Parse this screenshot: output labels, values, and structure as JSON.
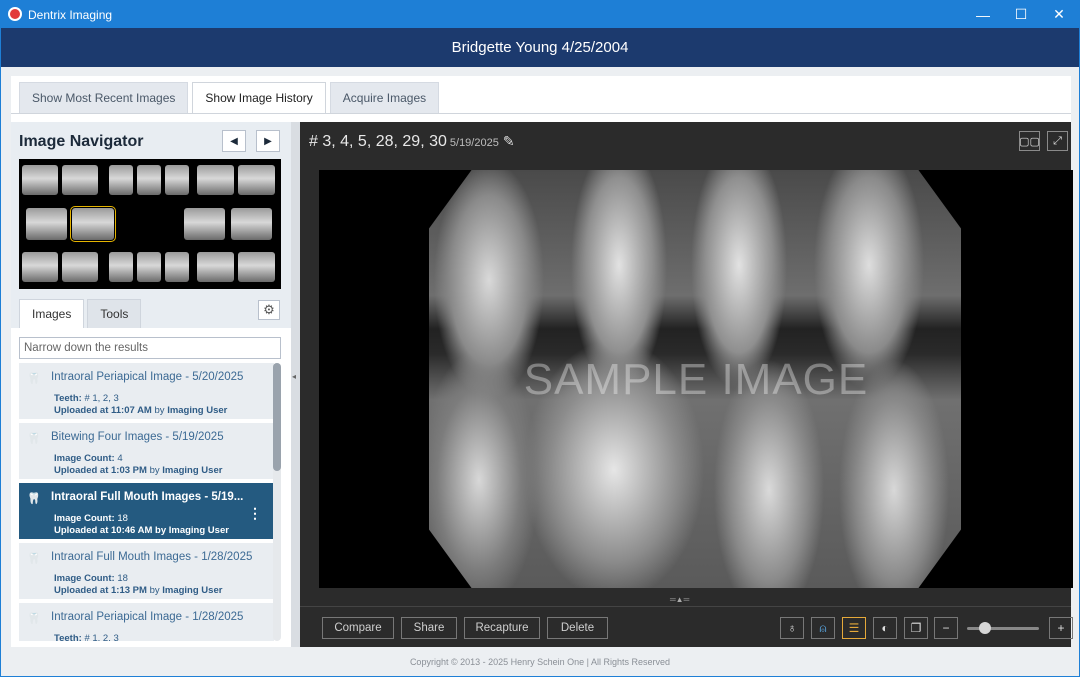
{
  "window": {
    "title": "Dentrix Imaging",
    "controls": {
      "minimize": "—",
      "maximize": "☐",
      "close": "✕"
    }
  },
  "header": {
    "patient": "Bridgette Young 4/25/2004"
  },
  "tabs": [
    {
      "label": "Show Most Recent Images",
      "active": false
    },
    {
      "label": "Show Image History",
      "active": true
    },
    {
      "label": "Acquire Images",
      "active": false
    }
  ],
  "navigator": {
    "title": "Image Navigator",
    "prev_icon": "◀",
    "next_icon": "▶"
  },
  "subtabs": [
    {
      "label": "Images",
      "active": true
    },
    {
      "label": "Tools",
      "active": false
    }
  ],
  "gear_icon": "⚙",
  "search": {
    "placeholder": "Narrow down the results",
    "value": ""
  },
  "history": [
    {
      "title": "Intraoral Periapical Image - 5/20/2025",
      "line1_label": "Teeth:",
      "line1_value": "# 1, 2, 3",
      "line2_label": "Uploaded at",
      "time": "11:07 AM",
      "by": "by",
      "user": "Imaging User",
      "selected": false
    },
    {
      "title": "Bitewing Four Images - 5/19/2025",
      "line1_label": "Image Count:",
      "line1_value": "4",
      "line2_label": "Uploaded at",
      "time": "1:03 PM",
      "by": "by",
      "user": "Imaging User",
      "selected": false
    },
    {
      "title": "Intraoral Full Mouth Images - 5/19...",
      "line1_label": "Image Count:",
      "line1_value": "18",
      "line2_label": "Uploaded at",
      "time": "10:46 AM",
      "by": "by",
      "user": "Imaging User",
      "selected": true
    },
    {
      "title": "Intraoral Full Mouth Images - 1/28/2025",
      "line1_label": "Image Count:",
      "line1_value": "18",
      "line2_label": "Uploaded at",
      "time": "1:13 PM",
      "by": "by",
      "user": "Imaging User",
      "selected": false
    },
    {
      "title": "Intraoral Periapical Image - 1/28/2025",
      "line1_label": "Teeth:",
      "line1_value": "# 1, 2, 3",
      "line2_label": "",
      "time": "",
      "by": "",
      "user": "",
      "selected": false
    }
  ],
  "viewer": {
    "teeth": "# 3, 4, 5, 28, 29, 30",
    "date": "5/19/2025",
    "edit_icon": "✎",
    "layout_icon": "▢▢",
    "fullscreen_icon": "⤢",
    "watermark": "SAMPLE IMAGE",
    "buttons": {
      "compare": "Compare",
      "share": "Share",
      "recapture": "Recapture",
      "delete": "Delete"
    },
    "zoom_out": "−",
    "zoom_in": "+",
    "zoom_level": 0.2
  },
  "footer": {
    "copyright": "Copyright © 2013 - 2025 Henry Schein One | All Rights Reserved"
  }
}
